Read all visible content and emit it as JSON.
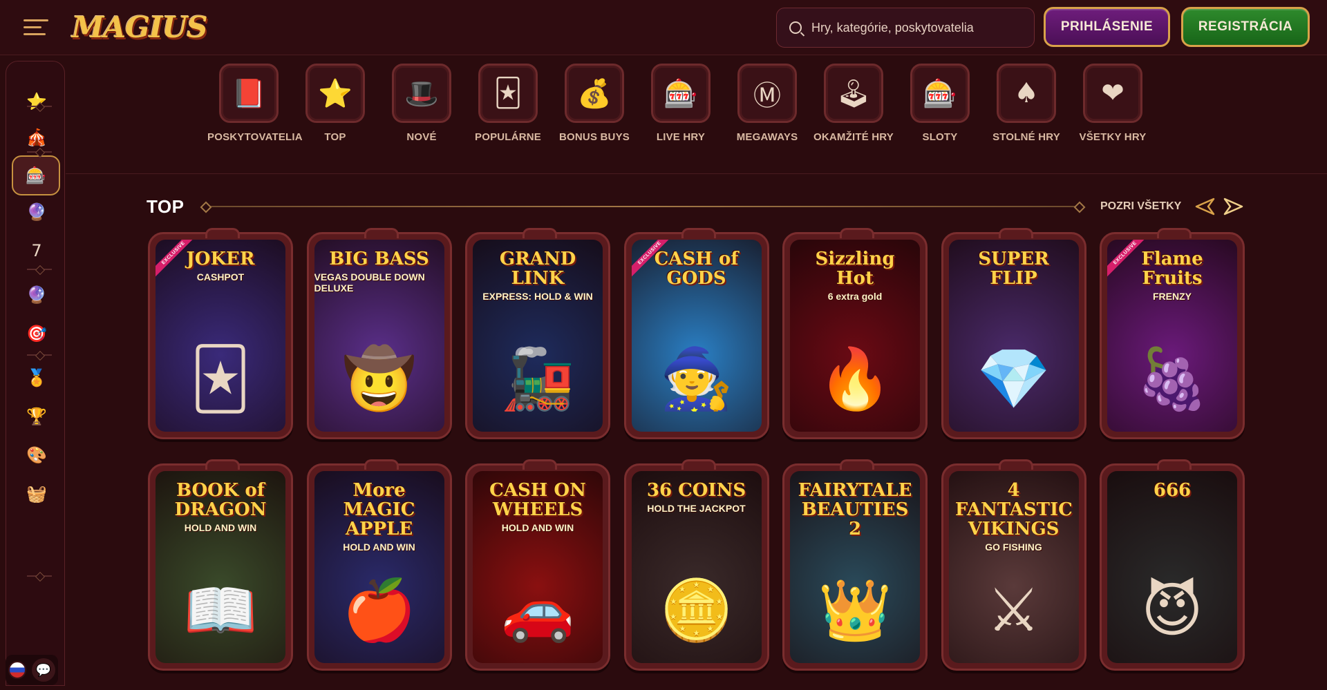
{
  "header": {
    "logo_text": "MAGIUS",
    "search_placeholder": "Hry, kategórie, poskytovatelia",
    "login_label": "PRIHLÁSENIE",
    "register_label": "REGISTRÁCIA"
  },
  "categories": [
    {
      "label": "POSKYTOVATELIA",
      "icon": "book-icon",
      "glyph": "📕"
    },
    {
      "label": "TOP",
      "icon": "star-box-icon",
      "glyph": "⭐"
    },
    {
      "label": "NOVÉ",
      "icon": "magic-hat-icon",
      "glyph": "🎩"
    },
    {
      "label": "POPULÁRNE",
      "icon": "jester-hat-icon",
      "glyph": "🃏"
    },
    {
      "label": "BONUS BUYS",
      "icon": "money-bag-icon",
      "glyph": "💰"
    },
    {
      "label": "LIVE HRY",
      "icon": "poker-chips-icon",
      "glyph": "🎰"
    },
    {
      "label": "MEGAWAYS",
      "icon": "megaways-m-icon",
      "glyph": "Ⓜ"
    },
    {
      "label": "OKAMŽITÉ HRY",
      "icon": "joystick-icon",
      "glyph": "🕹"
    },
    {
      "label": "SLOTY",
      "icon": "slot-reels-icon",
      "glyph": "🎰"
    },
    {
      "label": "STOLNÉ HRY",
      "icon": "spade-icon",
      "glyph": "♠"
    },
    {
      "label": "VŠETKY HRY",
      "icon": "heart-chip-icon",
      "glyph": "❤"
    }
  ],
  "section": {
    "title": "TOP",
    "see_all": "POZRI VŠETKY"
  },
  "games_row1": [
    {
      "name": "JOKER",
      "sub": "CASHPOT",
      "ribbon": "EXCLUSIVE",
      "glyph": "🃏",
      "bg": "#3a2a7a"
    },
    {
      "name": "BIG BASS",
      "sub": "VEGAS DOUBLE DOWN DELUXE",
      "ribbon": "",
      "glyph": "🤠",
      "bg": "#5a2f8a"
    },
    {
      "name": "GRAND LINK",
      "sub": "EXPRESS: HOLD & WIN",
      "ribbon": "",
      "glyph": "🚂",
      "bg": "#1e2b5c"
    },
    {
      "name": "CASH of GODS",
      "sub": "",
      "ribbon": "EXCLUSIVE",
      "glyph": "🧙",
      "bg": "#2a7fc4"
    },
    {
      "name": "Sizzling Hot",
      "sub": "6 extra gold",
      "ribbon": "",
      "glyph": "🔥",
      "bg": "#6a0a14"
    },
    {
      "name": "SUPER FLIP",
      "sub": "",
      "ribbon": "",
      "glyph": "💎",
      "bg": "#4a2a6a"
    },
    {
      "name": "Flame Fruits",
      "sub": "FRENZY",
      "ribbon": "EXCLUSIVE",
      "glyph": "🍇",
      "bg": "#6a1a7a"
    }
  ],
  "games_row2": [
    {
      "name": "BOOK of DRAGON",
      "sub": "HOLD AND WIN",
      "ribbon": "",
      "glyph": "📖",
      "bg": "#3a4a2a"
    },
    {
      "name": "More MAGIC APPLE",
      "sub": "HOLD AND WIN",
      "ribbon": "",
      "glyph": "🍎",
      "bg": "#2a2a6a"
    },
    {
      "name": "CASH ON WHEELS",
      "sub": "HOLD AND WIN",
      "ribbon": "",
      "glyph": "🚗",
      "bg": "#8a1010"
    },
    {
      "name": "36 COINS",
      "sub": "HOLD THE JACKPOT",
      "ribbon": "",
      "glyph": "🪙",
      "bg": "#3a2a2a"
    },
    {
      "name": "FAIRYTALE BEAUTIES 2",
      "sub": "",
      "ribbon": "",
      "glyph": "👑",
      "bg": "#2a4a5a"
    },
    {
      "name": "4 FANTASTIC VIKINGS",
      "sub": "GO FISHING",
      "ribbon": "",
      "glyph": "⚔",
      "bg": "#5a3a3a"
    },
    {
      "name": "666",
      "sub": "",
      "ribbon": "",
      "glyph": "😈",
      "bg": "#2a2a2a"
    }
  ],
  "sidebar": [
    {
      "icon": "star-icon",
      "glyph": "⭐"
    },
    {
      "icon": "circus-tent-icon",
      "glyph": "🎪"
    },
    {
      "icon": "slot-reels-icon",
      "glyph": "🎰"
    },
    {
      "icon": "crystal-ball-icon",
      "glyph": "🔮"
    },
    {
      "icon": "lucky-seven-icon",
      "glyph": "7"
    },
    {
      "icon": "fortune-teller-icon",
      "glyph": "🔮"
    },
    {
      "icon": "target-icon",
      "glyph": "🎯"
    },
    {
      "icon": "medal-icon",
      "glyph": "🏅"
    },
    {
      "icon": "trophy-icon",
      "glyph": "🏆"
    },
    {
      "icon": "palette-icon",
      "glyph": "🎨"
    },
    {
      "icon": "basket-icon",
      "glyph": "🧺"
    }
  ],
  "colors": {
    "background": "#2b0b0e",
    "login_button": "#5e1868",
    "register_button": "#237a22",
    "accent_gold": "#d9a24a"
  }
}
